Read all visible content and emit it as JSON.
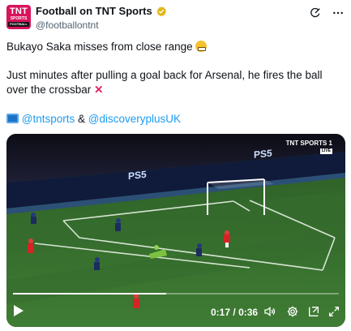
{
  "account": {
    "display_name": "Football on TNT Sports",
    "handle": "@footballontnt",
    "avatar_lines": [
      "TNT",
      "SPORTS",
      "FOOTBALL"
    ],
    "verified_icon": "gold-verified-badge-icon"
  },
  "header_actions": {
    "grok_icon": "grok-icon",
    "more_icon": "more-icon"
  },
  "tweet": {
    "line1": "Bukayo Saka misses from close range",
    "line2": "Just minutes after pulling a goal back for Arsenal, he fires the ball over the crossbar",
    "link1": "@tntsports",
    "amp": "&",
    "link2": "@discoveryplusUK",
    "emoji_grimace": "grimacing-face-emoji",
    "emoji_cross": "cross-mark-emoji",
    "emoji_tv": "television-emoji"
  },
  "video": {
    "broadcaster_label": "TNT SPORTS 1",
    "live_badge": "LIVE",
    "ad_board_text": "PS5",
    "current_time": "0:17",
    "separator": "/",
    "duration": "0:36",
    "progress_fraction": 0.47,
    "controls": [
      "play-icon",
      "volume-icon",
      "settings-icon",
      "picture-in-picture-icon",
      "fullscreen-icon"
    ]
  },
  "colors": {
    "brand_pink": "#d8145c",
    "link_blue": "#1d9bf0",
    "pitch_green": "#2f6b2a"
  }
}
